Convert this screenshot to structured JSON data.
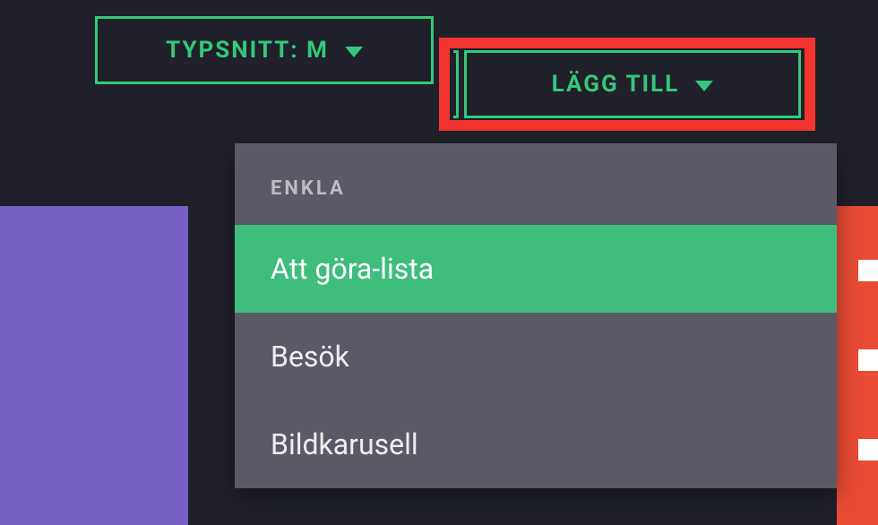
{
  "toolbar": {
    "typsnitt_label": "TYPSNITT: M",
    "lagg_label": "LÄGG TILL"
  },
  "dropdown": {
    "heading": "ENKLA",
    "items": [
      {
        "label": "Att göra-lista",
        "selected": true
      },
      {
        "label": "Besök",
        "selected": false
      },
      {
        "label": "Bildkarusell",
        "selected": false
      }
    ]
  },
  "highlight": {
    "color": "#f3342f"
  }
}
